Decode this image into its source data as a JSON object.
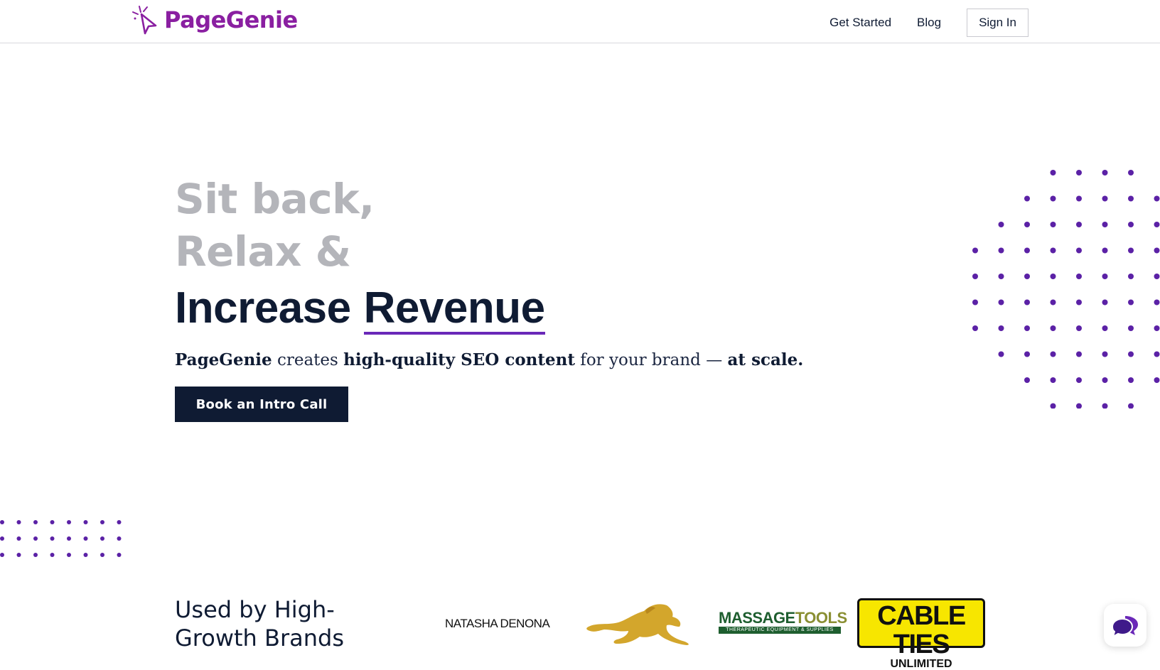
{
  "brand": {
    "name": "PageGenie",
    "color": "#8a1fa1"
  },
  "nav": {
    "get_started": "Get Started",
    "blog": "Blog",
    "sign_in": "Sign In"
  },
  "hero": {
    "line1": "Sit back,",
    "line2": "Relax &",
    "line3_word1": "Increase",
    "line3_word2": "Revenue",
    "tagline": {
      "brand": "PageGenie",
      "part1": " creates ",
      "bold1": "high-quality SEO content",
      "part2": " for your brand — ",
      "bold2": "at scale."
    },
    "cta_label": "Book an Intro Call"
  },
  "brands_section": {
    "title_line1": "Used by High-",
    "title_line2": "Growth Brands",
    "logos": {
      "natasha_denona": "NATASHA DENONA",
      "massage_word1": "MASSAGE",
      "massage_word2": "TOOLS",
      "massage_sub": "THERAPEUTIC EQUIPMENT & SUPPLIES",
      "cable_ties_top": "CABLE TIES",
      "cable_ties_bottom": "UNLIMITED"
    }
  },
  "colors": {
    "navy": "#0f1b33",
    "accent_purple": "#6a28b8",
    "faded_text": "#b4b5ba",
    "dot_purple": "#5b21a6"
  },
  "icons": {
    "logo": "magic-wand-cursor-icon",
    "chat": "chat-bubbles-icon"
  }
}
